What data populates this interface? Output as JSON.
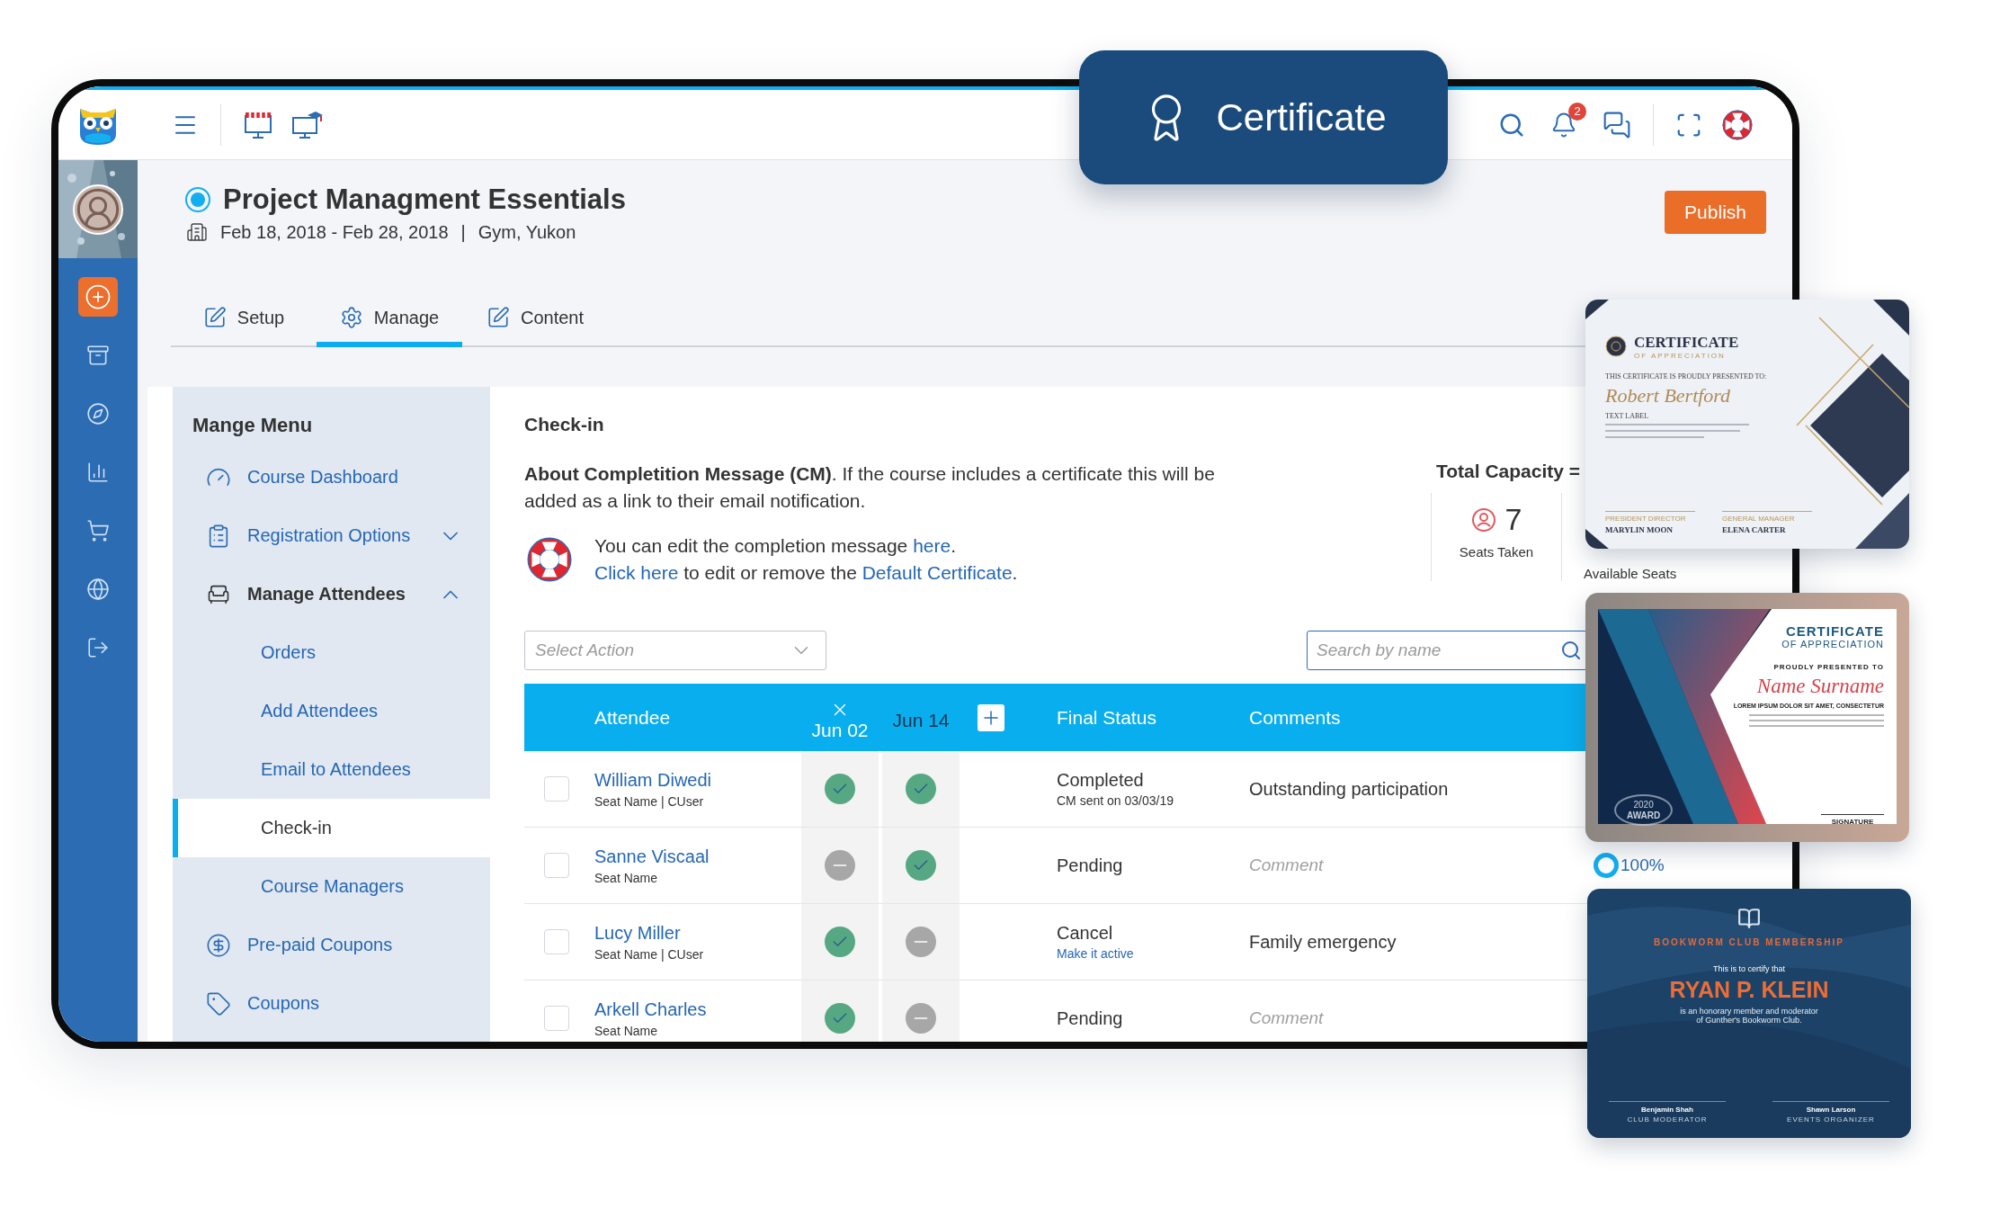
{
  "badge": {
    "label": "Certificate"
  },
  "topbar": {
    "notification_count": "2"
  },
  "course": {
    "title": "Project Managment Essentials",
    "dates": "Feb 18, 2018 - Feb 28, 2018",
    "separator": "|",
    "location": "Gym, Yukon",
    "publish": "Publish"
  },
  "tabs": [
    {
      "label": "Setup",
      "selected": false
    },
    {
      "label": "Manage",
      "selected": true
    },
    {
      "label": "Content",
      "selected": false
    }
  ],
  "menu": {
    "title": "Mange Menu",
    "items": [
      {
        "label": "Course Dashboard",
        "selected": false
      },
      {
        "label": "Registration Options",
        "selected": false,
        "expanded": false
      },
      {
        "label": "Manage Attendees",
        "selected": false,
        "expanded": true,
        "children": [
          {
            "label": "Orders",
            "selected": false
          },
          {
            "label": "Add Attendees",
            "selected": false
          },
          {
            "label": "Email to Attendees",
            "selected": false
          },
          {
            "label": "Check-in",
            "selected": true
          },
          {
            "label": "Course Managers",
            "selected": false
          }
        ]
      },
      {
        "label": "Pre-paid Coupons",
        "selected": false
      },
      {
        "label": "Coupons",
        "selected": false
      }
    ]
  },
  "checkin": {
    "title": "Check-in",
    "about": "**About Completition Message (CM)**. If the course includes a certificate this will be added as a link to their email notification.",
    "notice": [
      [
        {
          "text": "You can edit the completion message ",
          "link": false
        },
        {
          "text": "here",
          "link": true
        },
        {
          "text": ".",
          "link": false
        }
      ],
      [
        {
          "text": "Click here",
          "link": true
        },
        {
          "text": " to edit or remove the ",
          "link": false
        },
        {
          "text": "Default Certificate",
          "link": true
        },
        {
          "text": ".",
          "link": false
        }
      ]
    ]
  },
  "capacity": {
    "title": "Total Capacity =",
    "seats_taken": "7",
    "seats_taken_label": "Seats Taken",
    "available_label": "Available Seats"
  },
  "filters": {
    "action": {
      "placeholder": "Select Action"
    },
    "search": {
      "placeholder": "Search by name"
    }
  },
  "table": {
    "columns": [
      {
        "label": "Attendee",
        "removable": false
      },
      {
        "label": "Jun 02",
        "removable": true
      },
      {
        "label": "Jun 14",
        "removable": false
      },
      {
        "label": "Final Status",
        "removable": false
      },
      {
        "label": "Comments",
        "removable": false
      }
    ],
    "rows": [
      {
        "name": "William Diwedi",
        "seat": "Seat Name | CUser",
        "checked": false,
        "days": [
          true,
          true
        ],
        "status": "Completed",
        "status_note": "CM sent on 03/03/19",
        "comment": "Outstanding participation"
      },
      {
        "name": "Sanne Viscaal",
        "seat": "Seat Name",
        "checked": false,
        "days": [
          false,
          true
        ],
        "status": "Pending",
        "comment_placeholder": "Comment",
        "column_6": "100%"
      },
      {
        "name": "Lucy Miller",
        "seat": "Seat Name | CUser",
        "checked": false,
        "days": [
          true,
          false
        ],
        "status": "Cancel",
        "status_link": "Make it active",
        "comment": "Family emergency"
      },
      {
        "name": "Arkell Charles",
        "seat": "Seat Name",
        "checked": false,
        "days": [
          true,
          false
        ],
        "status": "Pending",
        "comment_placeholder": "Comment"
      }
    ]
  },
  "certificates": [
    {
      "kind": "classic",
      "title": "CERTIFICATE",
      "subtitle": "OF APPRECIATION",
      "intro": "THIS CERTIFICATE IS PROUDLY PRESENTED TO:",
      "name": "Robert Bertford",
      "label": "TEXT LABEL",
      "signers": [
        {
          "role": "PRESIDENT DIRECTOR",
          "name": "MARYLIN MOON"
        },
        {
          "role": "GENERAL MANAGER",
          "name": "ELENA CARTER"
        }
      ]
    },
    {
      "kind": "modern",
      "title": "CERTIFICATE",
      "subtitle": "OF APPRECIATION",
      "intro": "PROUDLY PRESENTED TO",
      "name": "Name Surname",
      "label": "LOREM IPSUM DOLOR SIT AMET, CONSECTETUR",
      "award_year": "2020",
      "award": "AWARD",
      "signature": "SIGNATURE"
    },
    {
      "kind": "membership",
      "title": "BOOKWORM CLUB MEMBERSHIP",
      "intro": "This is to certify that",
      "name": "RYAN P. KLEIN",
      "lines": [
        "is an honorary member and moderator",
        "of Gunther's Bookworm Club."
      ],
      "signers": [
        {
          "name": "Benjamin Shah",
          "role": "CLUB MODERATOR"
        },
        {
          "name": "Shawn Larson",
          "role": "EVENTS ORGANIZER"
        }
      ]
    }
  ]
}
